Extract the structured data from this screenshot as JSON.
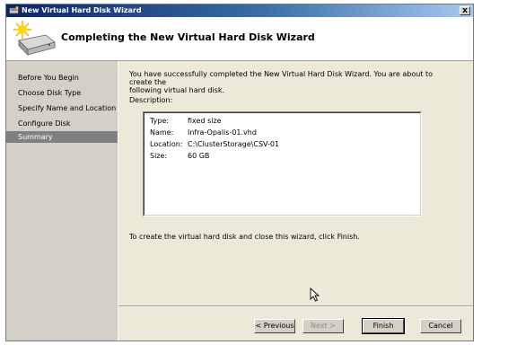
{
  "window": {
    "title": "New Virtual Hard Disk Wizard",
    "close_label": "x"
  },
  "header": {
    "title": "Completing the New Virtual Hard Disk Wizard"
  },
  "nav": {
    "items": [
      {
        "label": "Before You Begin",
        "active": false
      },
      {
        "label": "Choose Disk Type",
        "active": false
      },
      {
        "label": "Specify Name and Location",
        "active": false
      },
      {
        "label": "Configure Disk",
        "active": false
      },
      {
        "label": "Summary",
        "active": true
      }
    ]
  },
  "content": {
    "intro_line1": "You have successfully completed the New Virtual Hard Disk Wizard. You are about to create the",
    "intro_line2": "following virtual hard disk.",
    "description_label": "Description:",
    "description": [
      {
        "key": "Type:",
        "value": "fixed size"
      },
      {
        "key": "Name:",
        "value": "Infra-Opalis-01.vhd"
      },
      {
        "key": "Location:",
        "value": "C:\\ClusterStorage\\CSV-01"
      },
      {
        "key": "Size:",
        "value": "60 GB"
      }
    ],
    "finish_note": "To create the virtual hard disk and close this wizard, click Finish."
  },
  "buttons": {
    "previous": "< Previous",
    "next": "Next >",
    "finish": "Finish",
    "cancel": "Cancel"
  }
}
